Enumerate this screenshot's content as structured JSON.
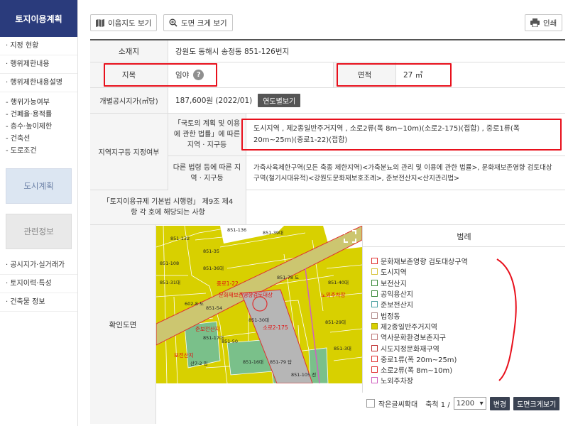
{
  "sidebar": {
    "header": "토지이용계획",
    "items": [
      {
        "label": "· 지정 현황"
      },
      {
        "label": "· 행위제한내용"
      },
      {
        "label": "· 행위제한내용설명"
      }
    ],
    "subitems": [
      {
        "label": "- 행위가능여부"
      },
      {
        "label": "- 건폐율·용적률"
      },
      {
        "label": "- 층수·높이제한"
      },
      {
        "label": "- 건축선"
      },
      {
        "label": "- 도로조건"
      }
    ],
    "city_plan": "도시계획",
    "related_info": "관련정보",
    "links": [
      {
        "label": "· 공시지가·실거래가"
      },
      {
        "label": "· 토지이력·특성"
      },
      {
        "label": "· 건축물 정보"
      }
    ]
  },
  "toolbar": {
    "map_view": "이음지도 보기",
    "map_enlarge": "도면 크게 보기",
    "print": "인쇄"
  },
  "info": {
    "location_label": "소재지",
    "location_value": "강원도 동해시 송정동 851-126번지",
    "land_category_label": "지목",
    "land_category_value": "임야",
    "help": "?",
    "area_label": "면적",
    "area_value": "27 ㎡",
    "price_label": "개별공시지가(㎡당)",
    "price_value": "187,600원 (2022/01)",
    "price_button": "연도별보기",
    "zone_label": "지역지구등 지정여부",
    "law1_label": "「국토의 계획 및 이용에 관한 법률」에 따른 지역 · 지구등",
    "law1_value": "도시지역 , 제2종일반주거지역 , 소로2류(폭 8m~10m)(소로2-175)(접합) , 중로1류(폭 20m~25m)(중로1-22)(접합)",
    "law2_label": "다른 법령 등에 따른 지역 · 지구등",
    "law2_value": "가축사육제한구역(모든 축종 제한지역)<가축분뇨의 관리 및 이용에 관한 법률>, 문화재보존영향 검토대상구역(철기시대유적)<강원도문화재보호조례>, 준보전산지<산지관리법>",
    "enforcement_label": "「토지이용규제 기본법 시행령」 제9조 제4항 각 호에 해당되는 사항",
    "map_label": "확인도면"
  },
  "map": {
    "labels": [
      {
        "t": "851-35"
      },
      {
        "t": "851-39대"
      },
      {
        "t": "851-36대"
      },
      {
        "t": "851-31대"
      },
      {
        "t": "851-30대"
      },
      {
        "t": "851-29대"
      },
      {
        "t": "851-40대"
      },
      {
        "t": "851-3대"
      },
      {
        "t": "851-16대"
      },
      {
        "t": "851-79 답"
      },
      {
        "t": "602-8 도"
      },
      {
        "t": "산7-2 임"
      },
      {
        "t": "851-105 전"
      },
      {
        "t": "851-132"
      },
      {
        "t": "851-136"
      },
      {
        "t": "851-54"
      },
      {
        "t": "851-17대"
      },
      {
        "t": "851-108"
      },
      {
        "t": "851-78 도"
      },
      {
        "t": "851-50"
      }
    ],
    "red_labels": [
      {
        "t": "중로1-22"
      },
      {
        "t": "문화재보존영향검토대상"
      },
      {
        "t": "소로2-175"
      },
      {
        "t": "준보전산지"
      },
      {
        "t": "보전산지"
      },
      {
        "t": "노외주차장"
      }
    ]
  },
  "legend": {
    "title": "범례",
    "items": [
      {
        "label": "문화재보존영향 검토대상구역",
        "color": "#ffffff",
        "border": "#e03030"
      },
      {
        "label": "도시지역",
        "color": "#ffffff",
        "border": "#d6c23a"
      },
      {
        "label": "보전산지",
        "color": "#ffffff",
        "border": "#3a8a3a"
      },
      {
        "label": "공익용산지",
        "color": "#ffffff",
        "border": "#3a8a3a"
      },
      {
        "label": "준보전산지",
        "color": "#ffffff",
        "border": "#4aa0a0"
      },
      {
        "label": "법정동",
        "color": "#ffffff",
        "border": "#b08a8a"
      },
      {
        "label": "제2종일반주거지역",
        "color": "#d8d000",
        "border": "#a8a000"
      },
      {
        "label": "역사문화환경보존지구",
        "color": "#ffffff",
        "border": "#c07a7a"
      },
      {
        "label": "시도지정문화재구역",
        "color": "#ffffff",
        "border": "#c03030"
      },
      {
        "label": "중로1류(폭 20m~25m)",
        "color": "#ffffff",
        "border": "#e03030"
      },
      {
        "label": "소로2류(폭 8m~10m)",
        "color": "#ffffff",
        "border": "#e03030"
      },
      {
        "label": "노외주차장",
        "color": "#ffffff",
        "border": "#d060c0"
      }
    ],
    "small_text": "작은글씨확대",
    "scale_label": "축척 1 /",
    "scale_value": "1200",
    "change_button": "변경",
    "enlarge_button": "도면크게보기"
  },
  "colors": {
    "sidebar_header": "#2a3b7c",
    "highlight": "#e8101c",
    "map_zone": "#d8d000"
  }
}
